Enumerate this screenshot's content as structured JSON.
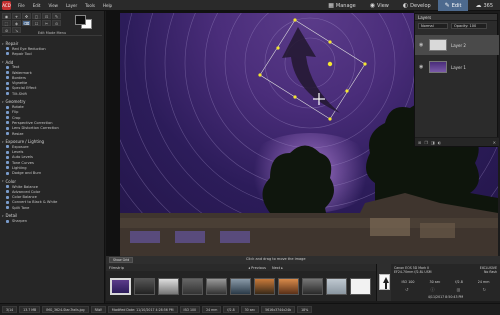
{
  "app": {
    "logo": "ACD"
  },
  "menubar": {
    "items": [
      "File",
      "Edit",
      "View",
      "Layer",
      "Tools",
      "Help"
    ]
  },
  "modes": [
    {
      "icon": "manage-icon",
      "label": "Manage",
      "active": false
    },
    {
      "icon": "view-icon",
      "label": "View",
      "active": false
    },
    {
      "icon": "develop-icon",
      "label": "Develop",
      "active": false
    },
    {
      "icon": "edit-icon",
      "label": "Edit",
      "active": true
    },
    {
      "icon": "365-icon",
      "label": "365",
      "active": false
    }
  ],
  "left_panel": {
    "tools": [
      "◉",
      "⌖",
      "✥",
      "◻",
      "⊡",
      "✎",
      "⬚",
      "◈",
      "⌫",
      "☐",
      "✂",
      "⊙",
      "⊘",
      "↘"
    ],
    "header": "Edit Mode Menu",
    "categories": [
      {
        "name": "Repair",
        "items": [
          "Red Eye Reduction",
          "Repair Tool"
        ]
      },
      {
        "name": "Add",
        "items": [
          "Text",
          "Watermark",
          "Borders",
          "Vignette",
          "Special Effect",
          "Tilt-Shift"
        ]
      },
      {
        "name": "Geometry",
        "items": [
          "Rotate",
          "Flip",
          "Crop",
          "Perspective Correction",
          "Lens Distortion Correction",
          "Resize"
        ]
      },
      {
        "name": "Exposure / Lighting",
        "items": [
          "Exposure",
          "Levels",
          "Auto Levels",
          "Tone Curves",
          "Lighting",
          "Dodge and Burn"
        ]
      },
      {
        "name": "Color",
        "items": [
          "White Balance",
          "Advanced Color",
          "Color Balance",
          "Convert to Black & White",
          "Split Tone"
        ]
      },
      {
        "name": "Detail",
        "items": [
          "Sharpen"
        ]
      }
    ],
    "buttons": {
      "save": "Save",
      "done": "Done",
      "cancel": "Cancel"
    }
  },
  "layers": {
    "title": "Layers",
    "blend": "Normal",
    "opacity": "Opacity: 100",
    "items": [
      {
        "name": "Layer 2",
        "active": true
      },
      {
        "name": "Layer 1",
        "active": false
      }
    ]
  },
  "viewbar": {
    "show_grid": "Show Grid",
    "hint": "Click and drag to move the image"
  },
  "filmstrip": {
    "label": "Filmstrip",
    "previous": "◂ Previous",
    "next": "Next ▸"
  },
  "info": {
    "camera": "Canon EOS 5D Mark II",
    "lens": "EF24-70mm f/2.8L USM",
    "exposure_label": "EXCLUSIVE",
    "flash": "No flash",
    "iso": "ISO 100",
    "shutter": "30 sec",
    "aperture": "f/2.8",
    "focal": "24 mm",
    "date": "4/11/2017 8:50:43 PM"
  },
  "status": {
    "index": "3/14",
    "size": "13.7 MB",
    "filename": "IMG_3624-Star-Trails.jpg",
    "mode": "RAW",
    "modified": "Modified Date: 11/10/2017 4:28:56 PM",
    "iso": "ISO 100",
    "focal": "24 mm",
    "aperture": "f/2.8",
    "shutter": "30 sec",
    "dims": "5616x3744x24b",
    "zoom": "18%"
  }
}
